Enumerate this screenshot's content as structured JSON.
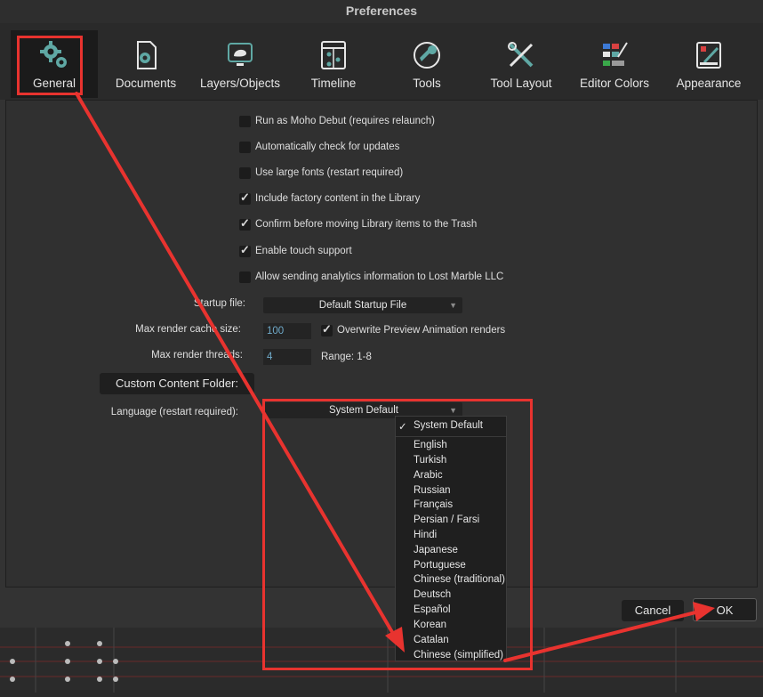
{
  "window": {
    "title": "Preferences"
  },
  "tabs": [
    {
      "label": "General",
      "icon": "gears-icon",
      "selected": true
    },
    {
      "label": "Documents",
      "icon": "document-gear-icon"
    },
    {
      "label": "Layers/Objects",
      "icon": "monitor-object-icon"
    },
    {
      "label": "Timeline",
      "icon": "timeline-icon"
    },
    {
      "label": "Tools",
      "icon": "wrench-circle-icon"
    },
    {
      "label": "Tool Layout",
      "icon": "crossed-tools-icon"
    },
    {
      "label": "Editor Colors",
      "icon": "color-swatches-icon"
    },
    {
      "label": "Appearance",
      "icon": "appearance-icon"
    }
  ],
  "options": [
    {
      "label": "Run as Moho Debut (requires relaunch)",
      "checked": false
    },
    {
      "label": "Automatically check for updates",
      "checked": false
    },
    {
      "label": "Use large fonts (restart required)",
      "checked": false
    },
    {
      "label": "Include factory content in the Library",
      "checked": true
    },
    {
      "label": "Confirm before moving Library items to the Trash",
      "checked": true
    },
    {
      "label": "Enable touch support",
      "checked": true
    },
    {
      "label": "Allow sending analytics information to Lost Marble LLC",
      "checked": false
    }
  ],
  "startup": {
    "label": "Startup file:",
    "value": "Default Startup File"
  },
  "cache": {
    "label": "Max render cache size:",
    "value": "100",
    "overwrite_label": "Overwrite Preview Animation renders",
    "overwrite_checked": true
  },
  "threads": {
    "label": "Max render threads:",
    "value": "4",
    "range": "Range: 1-8"
  },
  "custom_folder_button": "Custom Content Folder:",
  "language": {
    "label": "Language (restart required):",
    "value": "System Default",
    "selected": "System Default",
    "options": [
      "English",
      "Turkish",
      "Arabic",
      "Russian",
      "Français",
      "Persian / Farsi",
      "Hindi",
      "Japanese",
      "Portuguese",
      "Chinese (traditional)",
      "Deutsch",
      "Español",
      "Korean",
      "Catalan",
      "Chinese (simplified)"
    ]
  },
  "buttons": {
    "cancel": "Cancel",
    "ok": "OK"
  },
  "colors": {
    "annotation": "#e8332f",
    "accent_icon": "#5fa8a4"
  }
}
